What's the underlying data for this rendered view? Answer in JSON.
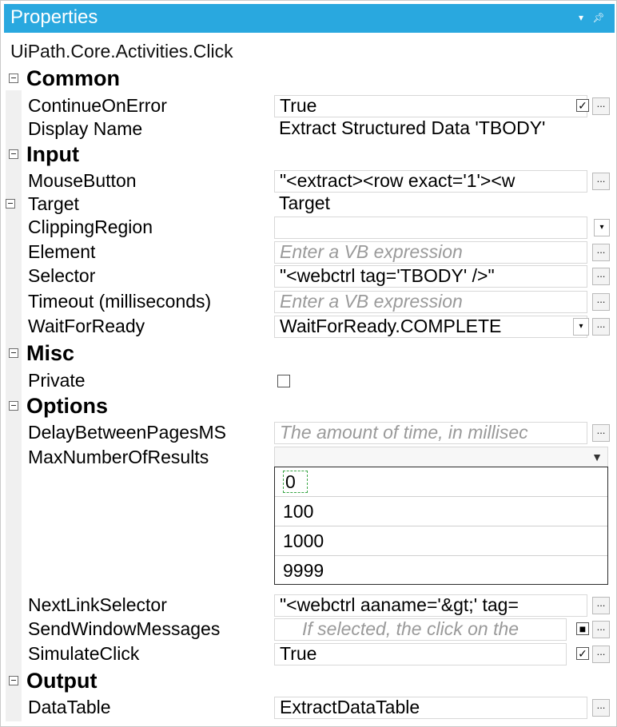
{
  "panel": {
    "title": "Properties",
    "pin_glyph": "▾ Ȩ",
    "type_name": "UiPath.Core.Activities.Click"
  },
  "categories": {
    "common": "Common",
    "input": "Input",
    "misc": "Misc",
    "options": "Options",
    "output": "Output"
  },
  "props": {
    "continue_on_error": {
      "name": "ContinueOnError",
      "value": "True"
    },
    "display_name": {
      "name": "Display Name",
      "value": "Extract Structured Data 'TBODY'"
    },
    "mouse_button": {
      "name": "MouseButton",
      "value": "\"<extract><row exact='1'><w"
    },
    "target": {
      "name": "Target",
      "value": "Target"
    },
    "clipping_region": {
      "name": "ClippingRegion",
      "value": ""
    },
    "element": {
      "name": "Element",
      "placeholder": "Enter a VB expression"
    },
    "selector": {
      "name": "Selector",
      "value": "\"<webctrl tag='TBODY' />\""
    },
    "timeout": {
      "name": "Timeout (milliseconds)",
      "placeholder": "Enter a VB expression"
    },
    "wait_for_ready": {
      "name": "WaitForReady",
      "value": "WaitForReady.COMPLETE"
    },
    "private": {
      "name": "Private"
    },
    "delay_between_pages": {
      "name": "DelayBetweenPagesMS",
      "placeholder": "The amount of time, in millisec"
    },
    "max_number_of_results": {
      "name": "MaxNumberOfResults",
      "value": ""
    },
    "next_link_selector": {
      "name": "NextLinkSelector",
      "value": "\"<webctrl aaname='&gt;' tag="
    },
    "send_window_messages": {
      "name": "SendWindowMessages",
      "placeholder": "If selected, the click on the"
    },
    "simulate_click": {
      "name": "SimulateClick",
      "value": "True"
    },
    "data_table": {
      "name": "DataTable",
      "value": "ExtractDataTable"
    }
  },
  "dropdown_options": [
    "0",
    "100",
    "1000",
    "9999"
  ],
  "glyphs": {
    "ellipsis": "...",
    "check": "✓",
    "down": "▾",
    "filled": "■"
  }
}
